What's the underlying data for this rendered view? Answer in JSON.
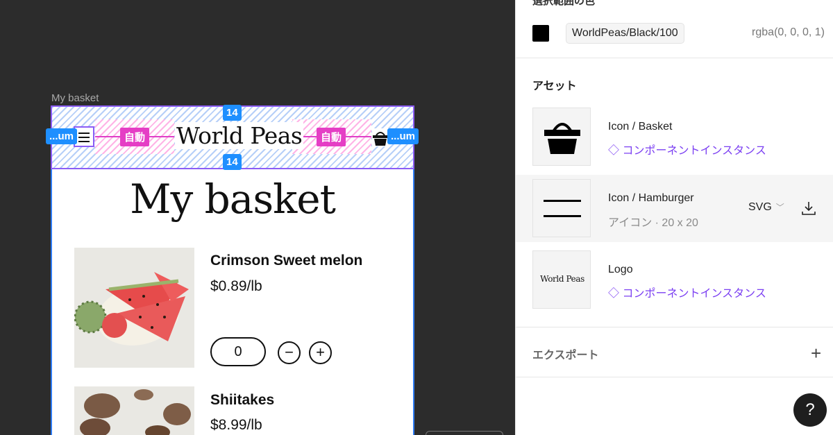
{
  "canvas": {
    "frame_label": "My basket",
    "spacing_top": "14",
    "spacing_bottom": "14",
    "left_tag": "...um",
    "right_tag": "...um",
    "auto_left": "自動",
    "auto_right": "自動",
    "logo": "World Peas",
    "page_title": "My basket",
    "products": [
      {
        "name": "Crimson Sweet melon",
        "price": "$0.89/lb",
        "qty": "0"
      },
      {
        "name": "Shiitakes",
        "price": "$8.99/lb"
      }
    ],
    "minus": "−",
    "plus": "+"
  },
  "panel": {
    "top_cut": "選択範囲の色",
    "color": {
      "swatch": "#000000",
      "variable": "WorldPeas/Black/100",
      "value": "rgba(0, 0, 0, 1)"
    },
    "assets_title": "アセット",
    "assets": [
      {
        "name": "Icon / Basket",
        "sub": "コンポーネントインスタンス",
        "icon": "diamond-icon"
      },
      {
        "name": "Icon / Hamburger",
        "sub": "アイコン · 20 x 20",
        "format": "SVG"
      },
      {
        "name": "Logo",
        "sub": "コンポーネントインスタンス",
        "thumb_text": "World Peas",
        "icon": "diamond-icon"
      }
    ],
    "export_title": "エクスポート",
    "add": "+",
    "help": "?"
  },
  "colors": {
    "accent_purple": "#7b3ff2",
    "selection_blue": "#1e8fff",
    "spacing_pink": "#e53ec5"
  }
}
